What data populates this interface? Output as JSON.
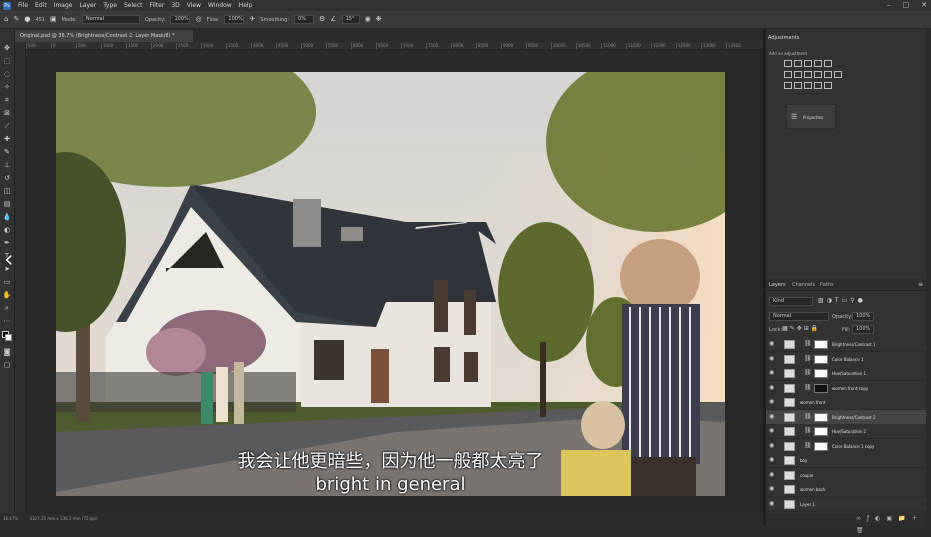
{
  "menu": {
    "logo": "Ps",
    "items": [
      "File",
      "Edit",
      "Image",
      "Layer",
      "Type",
      "Select",
      "Filter",
      "3D",
      "View",
      "Window",
      "Help"
    ]
  },
  "options": {
    "mode_label": "Mode:",
    "mode_value": "Normal",
    "opacity_label": "Opacity:",
    "opacity_value": "100%",
    "flow_label": "Flow:",
    "flow_value": "100%",
    "smoothing_label": "Smoothing:",
    "smoothing_value": "0%",
    "angle_value": "15°",
    "brush_size": "451"
  },
  "document": {
    "tab_title": "Original.psd @ 36.7% (Brightness/Contrast 2, Layer Mask/8) *",
    "zoom": "36.67%",
    "dimensions": "3327.35 mm x 336.2 mm (72 ppi)"
  },
  "rulers": {
    "h_ticks": [
      "500",
      "0",
      "500",
      "1000",
      "1500",
      "2000",
      "2500",
      "3000",
      "3500",
      "4000",
      "4500",
      "5000",
      "5500",
      "6000",
      "6500",
      "7000",
      "7500",
      "8000",
      "8500",
      "9000",
      "9500",
      "10000",
      "10500",
      "11000",
      "11500",
      "12000",
      "12500",
      "13000",
      "13500"
    ]
  },
  "panels": {
    "adjustments_tab": "Adjustments",
    "add_adjustment": "Add an adjustment",
    "properties_label": "Properties",
    "layers_tab": "Layers",
    "channels_tab": "Channels",
    "paths_tab": "Paths",
    "kind_label": "Kind",
    "blend_mode": "Normal",
    "opacity_label": "Opacity:",
    "opacity_value": "100%",
    "lock_label": "Lock:",
    "fill_label": "Fill:",
    "fill_value": "100%"
  },
  "layers": [
    {
      "name": "Brightness/Contrast 1",
      "adj": true,
      "dark": false,
      "sel": false
    },
    {
      "name": "Color Balance 1",
      "adj": true,
      "dark": false,
      "sel": false
    },
    {
      "name": "Hue/Saturation 1",
      "adj": true,
      "dark": false,
      "sel": false
    },
    {
      "name": "women front copy",
      "adj": true,
      "dark": true,
      "sel": false
    },
    {
      "name": "women front",
      "adj": false,
      "dark": false,
      "sel": false
    },
    {
      "name": "Brightness/Contrast 2",
      "adj": true,
      "dark": false,
      "sel": true
    },
    {
      "name": "Hue/Saturation 2",
      "adj": true,
      "dark": false,
      "sel": false
    },
    {
      "name": "Color Balance 1 copy",
      "adj": true,
      "dark": false,
      "sel": false
    },
    {
      "name": "boy",
      "adj": false,
      "dark": false,
      "sel": false
    },
    {
      "name": "couple",
      "adj": false,
      "dark": false,
      "sel": false
    },
    {
      "name": "women back",
      "adj": false,
      "dark": false,
      "sel": false
    },
    {
      "name": "Layer 1",
      "adj": false,
      "dark": false,
      "sel": false
    }
  ],
  "subtitles": {
    "zh": "我会让他更暗些，因为他一般都太亮了",
    "en": "bright in general"
  }
}
